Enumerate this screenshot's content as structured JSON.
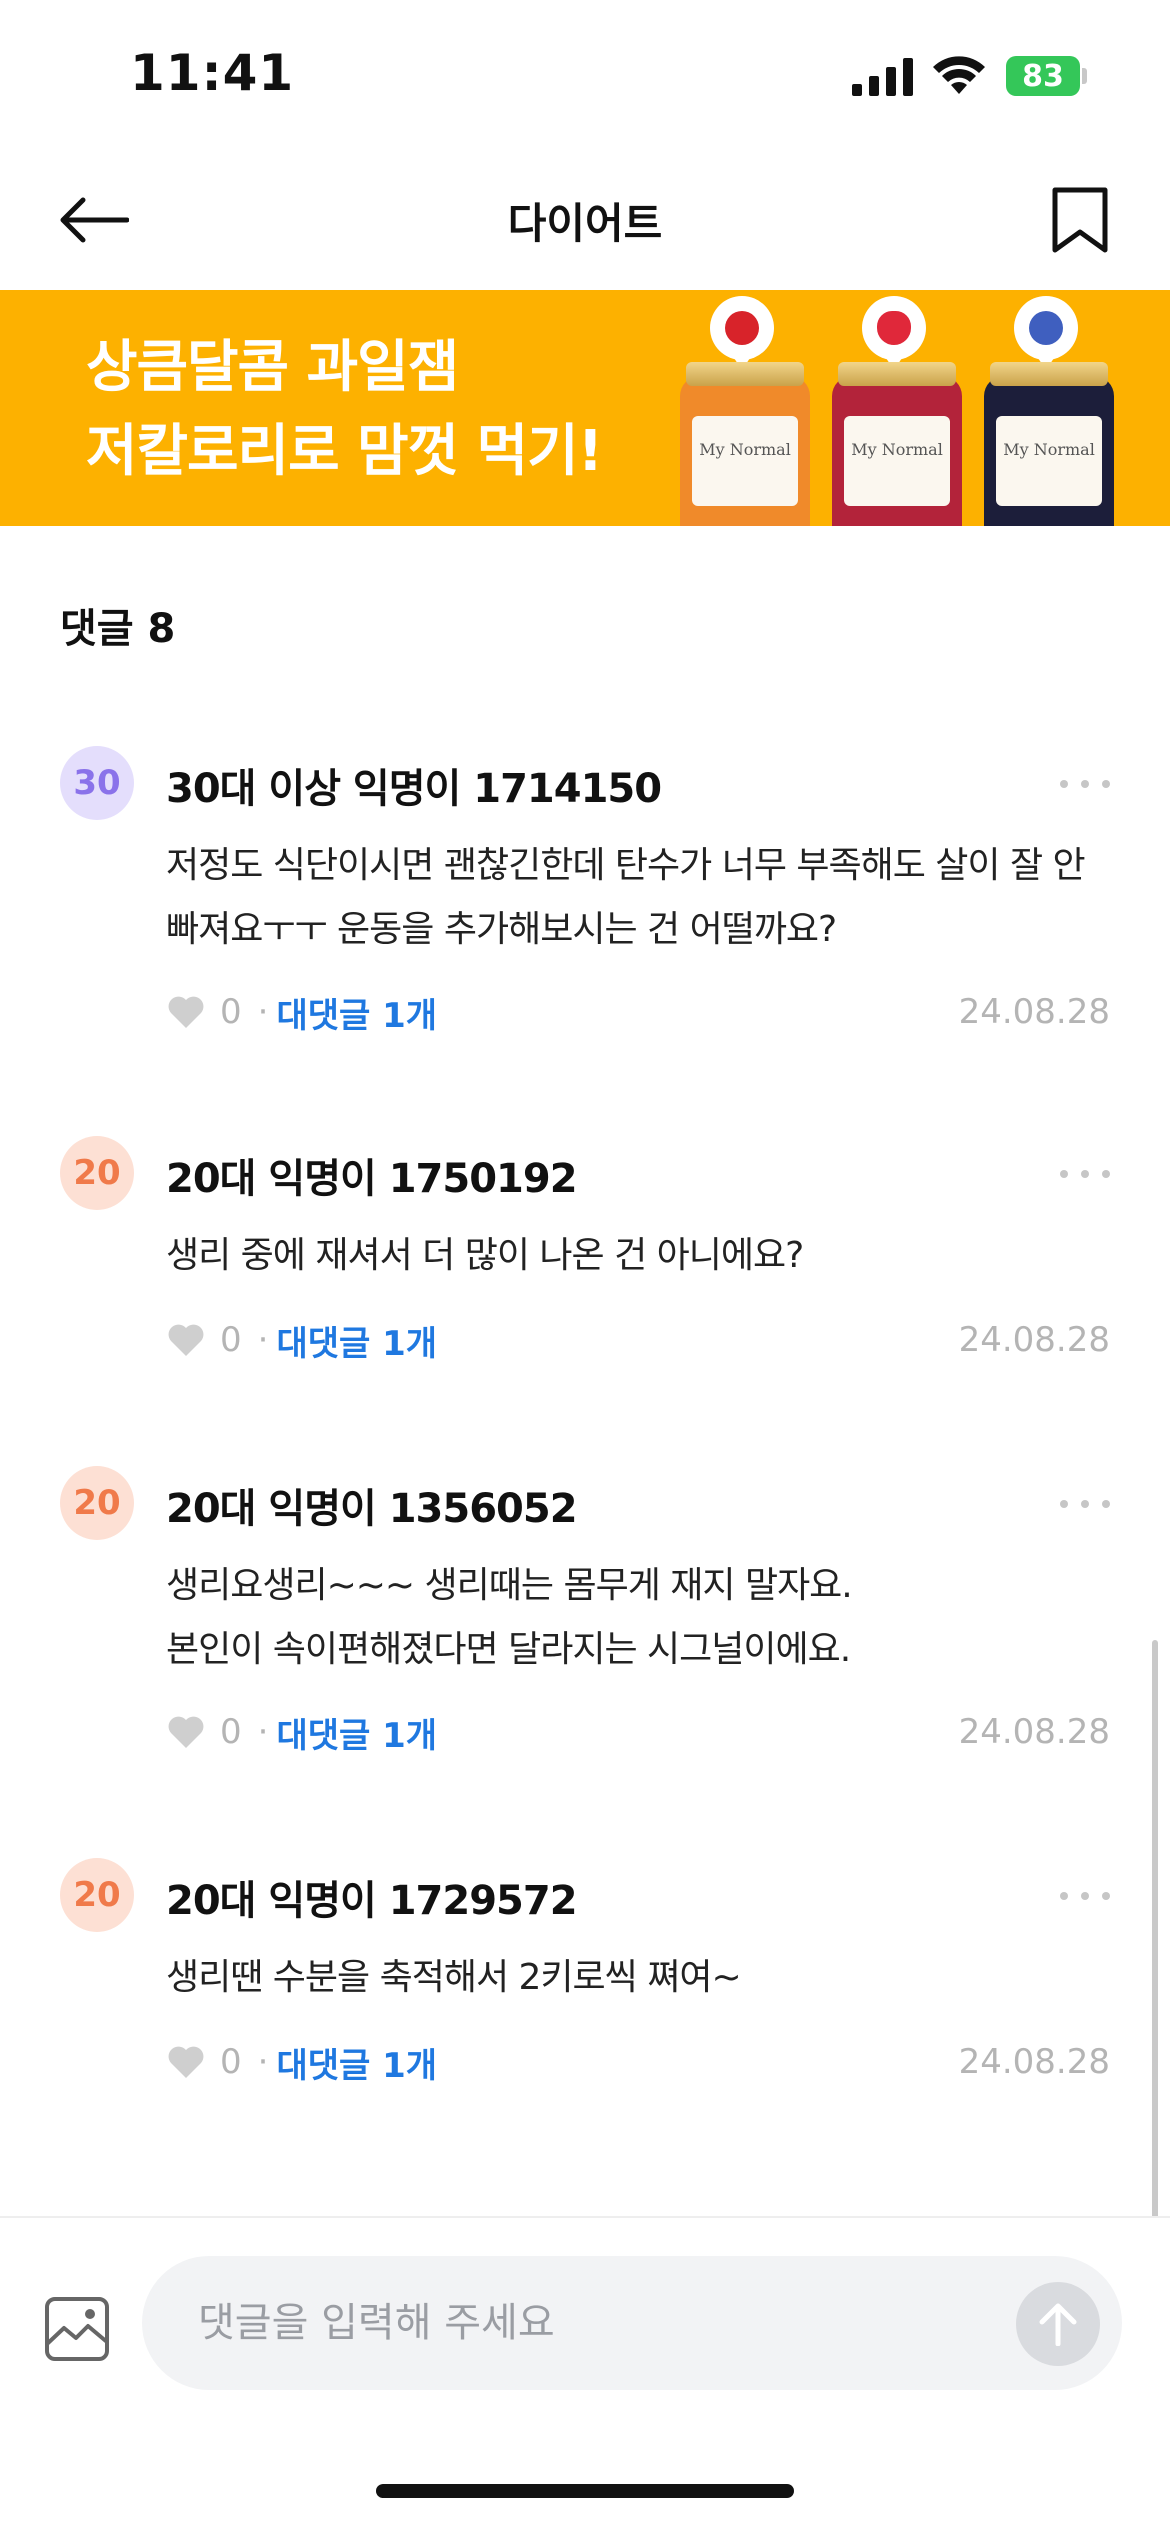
{
  "status_bar": {
    "time": "11:41",
    "battery": "83"
  },
  "header": {
    "title": "다이어트"
  },
  "banner": {
    "line1": "상큼달콤 과일잼",
    "line2": "저칼로리로 맘껏 먹기!",
    "jars": [
      {
        "label_brand": "My Normal",
        "fruit": "apple",
        "color": "#f08a2a"
      },
      {
        "label_brand": "My Normal",
        "fruit": "strawberry",
        "color": "#b3233a"
      },
      {
        "label_brand": "My Normal",
        "fruit": "blueberry",
        "color": "#1c1e3a"
      }
    ],
    "background_color": "#fdb100"
  },
  "comments_section": {
    "heading": "댓글 8",
    "comments": [
      {
        "avatar": "30",
        "author": "30대 이상 익명이 1714150",
        "text": "저정도 식단이시면 괜찮긴한데 탄수가 너무 부족해도 살이 잘 안빠져요ㅜㅜ 운동을 추가해보시는 건 어떨까요?",
        "likes": "0",
        "replies": "대댓글 1개",
        "date": "24.08.28"
      },
      {
        "avatar": "20",
        "author": "20대 익명이 1750192",
        "text": "생리 중에 재셔서 더 많이 나온 건 아니에요?",
        "likes": "0",
        "replies": "대댓글 1개",
        "date": "24.08.28"
      },
      {
        "avatar": "20",
        "author": "20대 익명이 1356052",
        "text_line1": "생리요생리~~~ 생리때는 몸무게 재지 말자요.",
        "text_line2": "본인이 속이편해졌다면 달라지는 시그널이에요.",
        "likes": "0",
        "replies": "대댓글 1개",
        "date": "24.08.28"
      },
      {
        "avatar": "20",
        "author": "20대 익명이 1729572",
        "text": "생리땐 수분을 축적해서 2키로씩 쪄여~",
        "likes": "0",
        "replies": "대댓글 1개",
        "date": "24.08.28"
      }
    ]
  },
  "input_bar": {
    "placeholder": "댓글을 입력해 주세요"
  },
  "colors": {
    "avatar_30_bg": "#e4defc",
    "avatar_30_fg": "#8a72ea",
    "avatar_20_bg": "#fde0d4",
    "avatar_20_fg": "#f07a4a",
    "reply_link": "#1f78e0"
  }
}
